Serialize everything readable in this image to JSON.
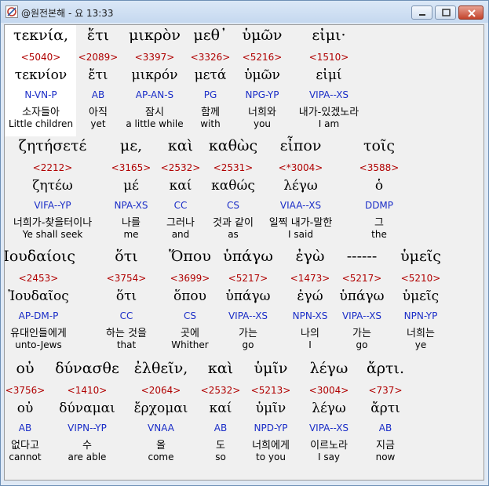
{
  "window": {
    "title": "@원전본해 - 요 13:33",
    "controls": {
      "minimize": "minimize",
      "maximize": "maximize",
      "close": "close"
    }
  },
  "rows": [
    {
      "words": [
        {
          "greek": "τεκνία,",
          "strongs": "<5040>",
          "lemma": "τεκνίον",
          "parse": "N-VN-P",
          "korean": "소자들아",
          "english": "Little children"
        },
        {
          "greek": "ἔτι",
          "strongs": "<2089>",
          "lemma": "ἔτι",
          "parse": "AB",
          "korean": "아직",
          "english": "yet"
        },
        {
          "greek": "μικρὸν",
          "strongs": "<3397>",
          "lemma": "μικρόν",
          "parse": "AP-AN-S",
          "korean": "잠시",
          "english": "a little while"
        },
        {
          "greek": "μεθ᾽",
          "strongs": "<3326>",
          "lemma": "μετά",
          "parse": "PG",
          "korean": "함께",
          "english": "with"
        },
        {
          "greek": "ὑμῶν",
          "strongs": "<5216>",
          "lemma": "ὑμῶν",
          "parse": "NPG-YP",
          "korean": "너희와",
          "english": "you"
        },
        {
          "greek": "εἰμι·",
          "strongs": "<1510>",
          "lemma": "εἰμί",
          "parse": "VIPA--XS",
          "korean": "내가-있겠노라",
          "english": "I am"
        }
      ]
    },
    {
      "words": [
        {
          "greek": "ζητήσετέ",
          "strongs": "<2212>",
          "lemma": "ζητέω",
          "parse": "VIFA--YP",
          "korean": "너희가-찾을터이나",
          "english": "Ye shall seek"
        },
        {
          "greek": "με,",
          "strongs": "<3165>",
          "lemma": "μέ",
          "parse": "NPA-XS",
          "korean": "나를",
          "english": "me"
        },
        {
          "greek": "καὶ",
          "strongs": "<2532>",
          "lemma": "καί",
          "parse": "CC",
          "korean": "그러나",
          "english": "and"
        },
        {
          "greek": "καθὼς",
          "strongs": "<2531>",
          "lemma": "καθώς",
          "parse": "CS",
          "korean": "것과 같이",
          "english": "as"
        },
        {
          "greek": "εἶπον",
          "strongs": "<*3004>",
          "lemma": "λέγω",
          "parse": "VIAA--XS",
          "korean": "일찍 내가-말한",
          "english": "I said"
        },
        {
          "greek": "τοῖς",
          "strongs": "<3588>",
          "lemma": "ὁ",
          "parse": "DDMP",
          "korean": "그",
          "english": "the"
        }
      ]
    },
    {
      "words": [
        {
          "greek": "Ἰουδαίοις",
          "strongs": "<2453>",
          "lemma": "Ἰουδαῖος",
          "parse": "AP-DM-P",
          "korean": "유대인들에게",
          "english": "unto-Jews"
        },
        {
          "greek": "ὅτι",
          "strongs": "<3754>",
          "lemma": "ὅτι",
          "parse": "CC",
          "korean": "하는 것을",
          "english": "that"
        },
        {
          "greek": "Ὅπου",
          "strongs": "<3699>",
          "lemma": "ὅπου",
          "parse": "CS",
          "korean": "곳에",
          "english": "Whither"
        },
        {
          "greek": "ὑπάγω",
          "strongs": "<5217>",
          "lemma": "ὑπάγω",
          "parse": "VIPA--XS",
          "korean": "가는",
          "english": "go"
        },
        {
          "greek": "ἐγὼ",
          "strongs": "<1473>",
          "lemma": "ἐγώ",
          "parse": "NPN-XS",
          "korean": "나의",
          "english": "I"
        },
        {
          "greek": "------",
          "strongs": "<5217>",
          "lemma": "ὑπάγω",
          "parse": "VIPA--XS",
          "korean": "가는",
          "english": "go"
        },
        {
          "greek": "ὑμεῖς",
          "strongs": "<5210>",
          "lemma": "ὑμεῖς",
          "parse": "NPN-YP",
          "korean": "너희는",
          "english": "ye"
        }
      ]
    },
    {
      "words": [
        {
          "greek": "οὐ",
          "strongs": "<3756>",
          "lemma": "οὐ",
          "parse": "AB",
          "korean": "없다고",
          "english": "cannot"
        },
        {
          "greek": "δύνασθε",
          "strongs": "<1410>",
          "lemma": "δύναμαι",
          "parse": "VIPN--YP",
          "korean": "수",
          "english": "are able"
        },
        {
          "greek": "ἐλθεῖν,",
          "strongs": "<2064>",
          "lemma": "ἔρχομαι",
          "parse": "VNAA",
          "korean": "올",
          "english": "come"
        },
        {
          "greek": "καὶ",
          "strongs": "<2532>",
          "lemma": "καί",
          "parse": "AB",
          "korean": "도",
          "english": "so"
        },
        {
          "greek": "ὑμῖν",
          "strongs": "<5213>",
          "lemma": "ὑμῖν",
          "parse": "NPD-YP",
          "korean": "너희에게",
          "english": "to you"
        },
        {
          "greek": "λέγω",
          "strongs": "<3004>",
          "lemma": "λέγω",
          "parse": "VIPA--XS",
          "korean": "이르노라",
          "english": "I say"
        },
        {
          "greek": "ἄρτι.",
          "strongs": "<737>",
          "lemma": "ἄρτι",
          "parse": "AB",
          "korean": "지금",
          "english": "now"
        }
      ]
    }
  ],
  "colors": {
    "strongs": "#b00000",
    "parse": "#1a2dc7",
    "selection": "#ffffff",
    "background": "#f0f0f0"
  }
}
